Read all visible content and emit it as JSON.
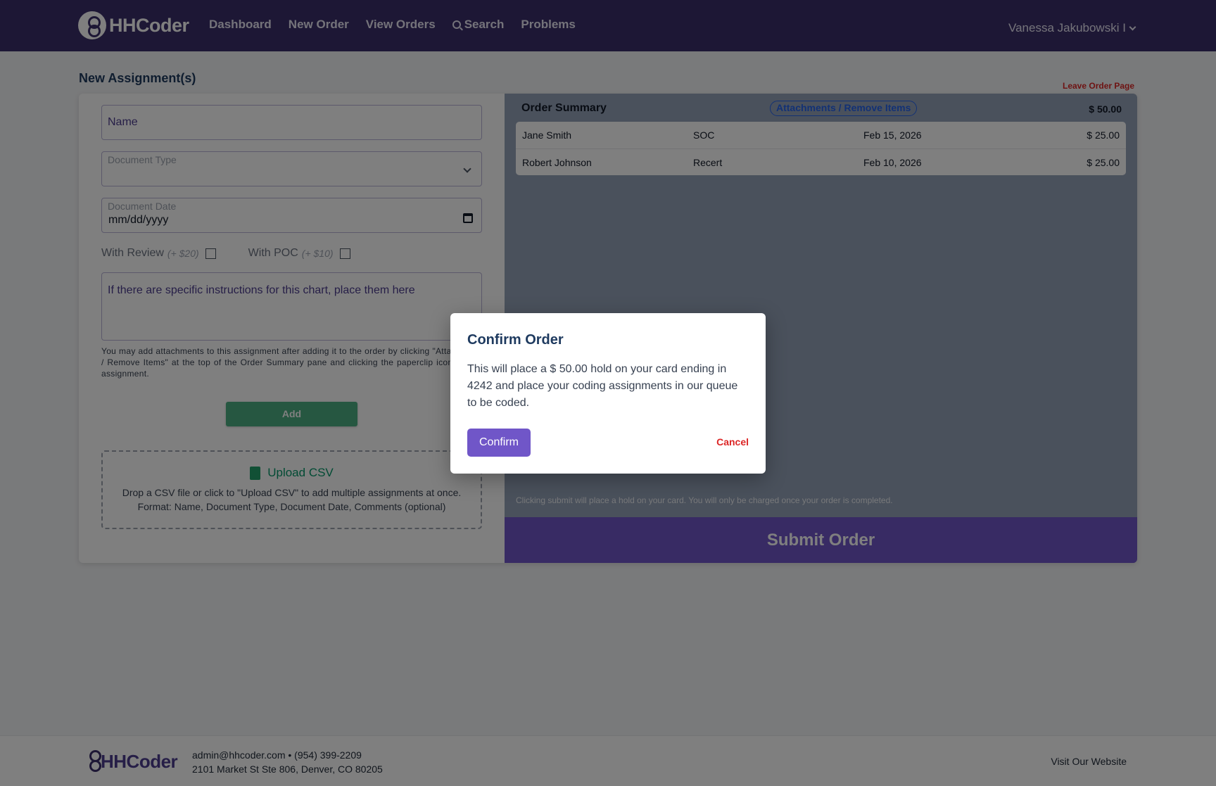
{
  "nav": {
    "brand": "HHCoder",
    "links": [
      "Dashboard",
      "New Order",
      "View Orders",
      "Search",
      "Problems"
    ],
    "user": "Vanessa Jakubowski I"
  },
  "page": {
    "title": "New Assignment(s)",
    "leave_link": "Leave Order Page"
  },
  "form": {
    "name_placeholder": "Name",
    "doc_type_label": "Document Type",
    "doc_date_label": "Document Date",
    "doc_date_value": "mm/dd/yyyy",
    "review_label": "With Review",
    "review_price": "(+ $20)",
    "poc_label": "With POC",
    "poc_price": "(+ $10)",
    "comments_placeholder": "If there are specific instructions for this chart, place them here",
    "attach_note": "You may add attachments to this assignment after adding it to the order by clicking \"Attachments / Remove Items\" at the top of the Order Summary pane and clicking the paperclip icon for that assignment.",
    "add_label": "Add"
  },
  "upload": {
    "title": "Upload CSV",
    "icon": "csv-file-icon",
    "line1": "Drop a CSV file or click to \"Upload CSV\" to add multiple assignments at once.",
    "line2": "Format: Name, Document Type, Document Date, Comments (optional)"
  },
  "summary": {
    "title": "Order Summary",
    "attach_btn": "Attachments / Remove Items",
    "total": "$ 50.00",
    "rows": [
      {
        "name": "Jane Smith",
        "type": "SOC",
        "date": "Feb 15, 2026",
        "price": "$ 25.00"
      },
      {
        "name": "Robert Johnson",
        "type": "Recert",
        "date": "Feb 10, 2026",
        "price": "$ 25.00"
      }
    ],
    "hold_note": "Clicking submit will place a hold on your card. You will only be charged once your order is completed.",
    "submit_label": "Submit Order"
  },
  "modal": {
    "title": "Confirm Order",
    "body": "This will place a $ 50.00 hold on your card ending in 4242 and place your coding assignments in our queue to be coded.",
    "confirm_label": "Confirm",
    "cancel_label": "Cancel"
  },
  "footer": {
    "brand": "HHCoder",
    "contact_line": "admin@hhcoder.com • (954) 399-2209",
    "address": "2101 Market St Ste 806, Denver, CO 80205",
    "website_link": "Visit Our Website"
  },
  "colors": {
    "nav_bg": "#3b2f6b",
    "accent": "#7056c8",
    "add_button": "#4caf82",
    "danger": "#dc2626"
  }
}
